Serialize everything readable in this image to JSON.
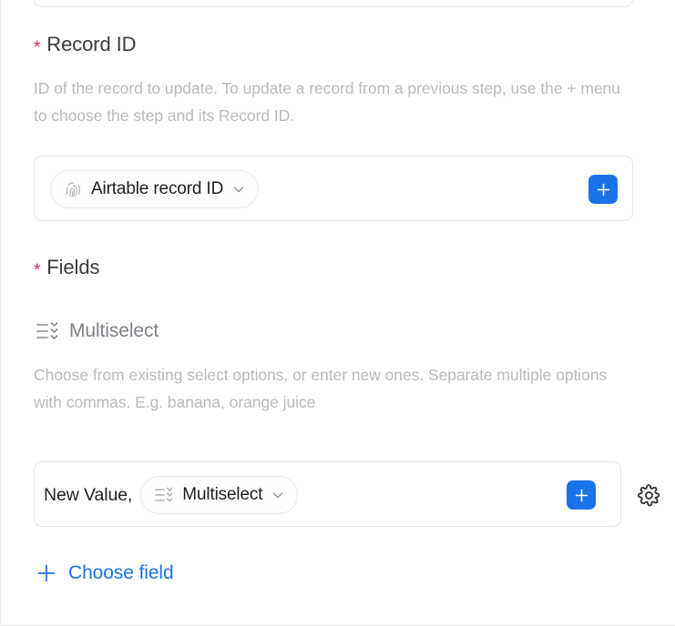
{
  "panel": {
    "record_id": {
      "required_marker": "*",
      "label": "Record ID",
      "description": "ID of the record to update. To update a record from a previous step, use the + menu to choose the step and its Record ID.",
      "token_label": "Airtable record ID",
      "token_icon": "fingerprint-icon",
      "dropdown_icon": "chevron-down-icon",
      "add_button_icon": "plus-icon"
    },
    "fields": {
      "required_marker": "*",
      "label": "Fields",
      "field_type_icon": "multiselect-icon",
      "field_type_label": "Multiselect",
      "description": "Choose from existing select options, or enter new ones. Separate multiple options with commas. E.g. banana, orange juice",
      "value_row": {
        "prefix_text": "New Value,",
        "token_icon": "multiselect-icon",
        "token_label": "Multiselect",
        "dropdown_icon": "chevron-down-icon",
        "add_button_icon": "plus-icon",
        "settings_icon": "gear-icon"
      },
      "choose_field": {
        "icon": "plus-icon",
        "label": "Choose field"
      }
    }
  },
  "colors": {
    "accent_blue": "#1a73e8",
    "required_pink": "#d6256b",
    "muted_text": "#b9babd",
    "heading_text": "#3b3b40",
    "border": "#e4e5e7"
  }
}
